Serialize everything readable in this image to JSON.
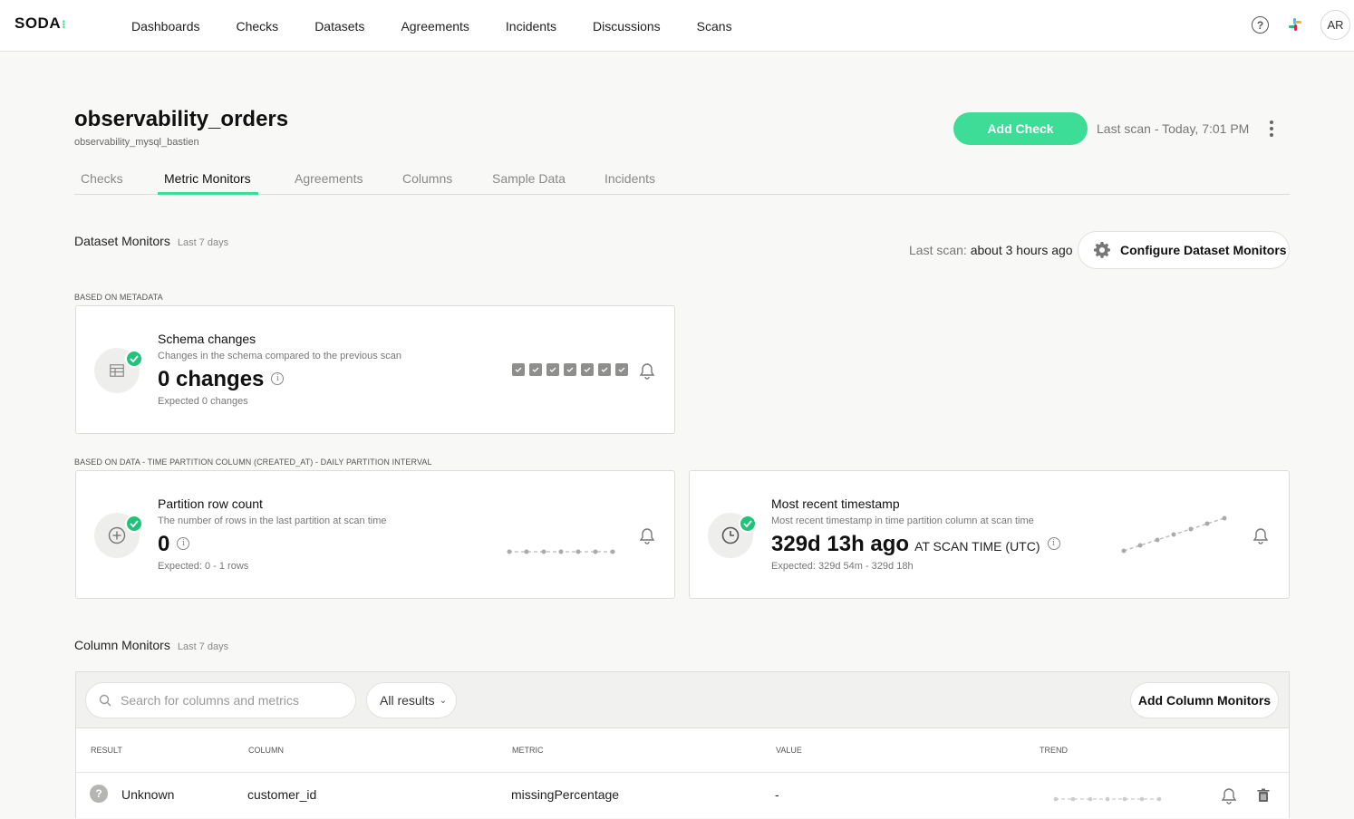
{
  "app": {
    "logo": "SODA",
    "nav": [
      "Dashboards",
      "Checks",
      "Datasets",
      "Agreements",
      "Incidents",
      "Discussions",
      "Scans"
    ],
    "help_icon": "?",
    "user_initials": "AR"
  },
  "dataset": {
    "name": "observability_orders",
    "source": "observability_mysql_bastien",
    "add_check_label": "Add Check",
    "last_scan": "Last scan - Today, 7:01 PM"
  },
  "tabs": [
    "Checks",
    "Metric Monitors",
    "Agreements",
    "Columns",
    "Sample Data",
    "Incidents"
  ],
  "active_tab": "Metric Monitors",
  "dataset_monitors": {
    "title": "Dataset Monitors",
    "period": "Last 7 days",
    "last_scan_prefix": "Last scan: ",
    "last_scan_value": "about 3 hours ago",
    "configure_label": "Configure Dataset Monitors",
    "metadata_label": "BASED ON METADATA",
    "data_label": "BASED ON DATA - TIME PARTITION COLUMN (CREATED_AT) - DAILY PARTITION INTERVAL",
    "schema": {
      "title": "Schema changes",
      "description": "Changes in the schema compared to the previous scan",
      "value": "0 changes",
      "expected": "Expected 0 changes",
      "status": "pass",
      "history_count": 7
    },
    "row_count": {
      "title": "Partition row count",
      "description": "The number of rows in the last partition at scan time",
      "value": "0",
      "expected": "Expected: 0 - 1 rows",
      "status": "pass"
    },
    "freshness": {
      "title": "Most recent timestamp",
      "description": "Most recent timestamp in time partition column at scan time",
      "value": "329d 13h ago",
      "value_suffix": "AT SCAN TIME (UTC)",
      "expected": "Expected: 329d 54m - 329d 18h",
      "status": "pass"
    }
  },
  "column_monitors": {
    "title": "Column Monitors",
    "period": "Last 7 days",
    "search_placeholder": "Search for columns and metrics",
    "filter_label": "All results",
    "add_label": "Add Column Monitors",
    "headers": [
      "RESULT",
      "COLUMN",
      "METRIC",
      "VALUE",
      "TREND"
    ],
    "rows": [
      {
        "result": "Unknown",
        "column": "customer_id",
        "metric": "missingPercentage",
        "value": "-"
      }
    ]
  },
  "colors": {
    "accent": "#3ddc97",
    "pass": "#21c27a",
    "unknown": "#b5b5b3"
  }
}
